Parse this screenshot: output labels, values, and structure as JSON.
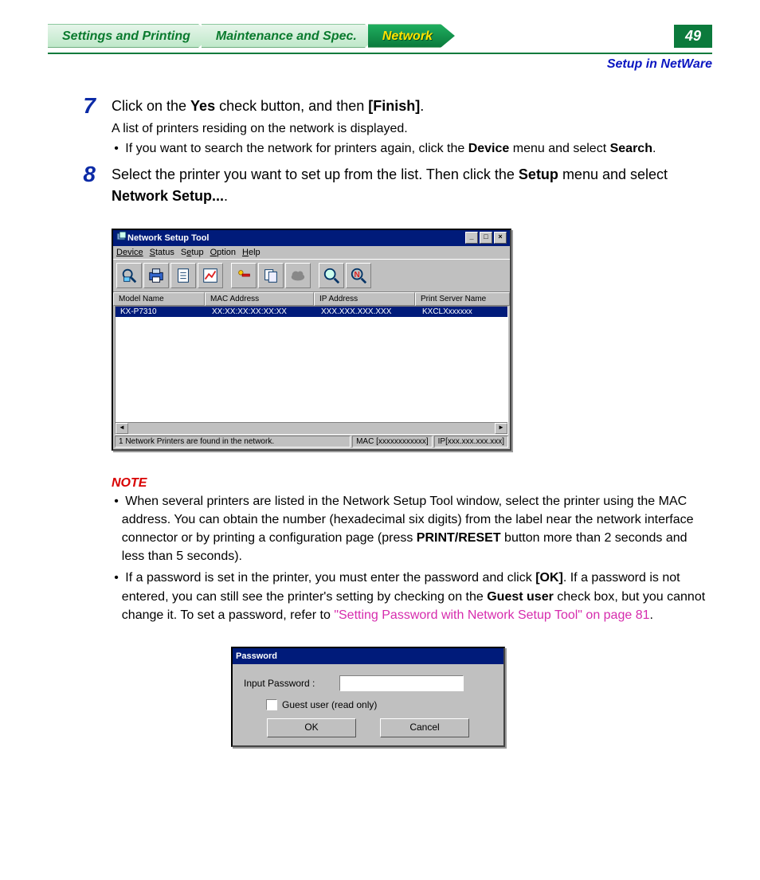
{
  "tabs": {
    "settings": "Settings and Printing",
    "maintenance": "Maintenance and Spec.",
    "network": "Network"
  },
  "page_number": "49",
  "section_path": "Setup in NetWare",
  "step7": {
    "num": "7",
    "line_pre": "Click on the ",
    "yes": "Yes",
    "line_mid": " check button, and then ",
    "finish": "[Finish]",
    "line_post": ".",
    "sub": "A list of printers residing on the network is displayed.",
    "bullet_pre": "If you want to search the network for printers again, click the ",
    "device": "Device",
    "bullet_mid": " menu and select ",
    "search": "Search",
    "bullet_post": "."
  },
  "step8": {
    "num": "8",
    "line_pre": "Select the printer you want to set up from the list. Then click the ",
    "setup": "Setup",
    "line_mid": " menu and select ",
    "ns": "Network Setup...",
    "line_post": "."
  },
  "nst": {
    "title": "Network Setup Tool",
    "menu": {
      "device": "Device",
      "status": "Status",
      "setup": "Setup",
      "option": "Option",
      "help": "Help"
    },
    "cols": {
      "model": "Model Name",
      "mac": "MAC Address",
      "ip": "IP Address",
      "ps": "Print Server Name"
    },
    "row": {
      "model": "KX-P7310",
      "mac": "XX:XX:XX:XX:XX:XX",
      "ip": "XXX.XXX.XXX.XXX",
      "ps": "KXCLXxxxxxx"
    },
    "status_main": "1 Network Printers are found in the network.",
    "status_mac": "MAC [xxxxxxxxxxxx]",
    "status_ip": "IP[xxx.xxx.xxx.xxx]"
  },
  "note": {
    "label": "NOTE",
    "b1_pre": "When several printers are listed in the Network Setup Tool window, select the printer using the MAC address. You can obtain the number (hexadecimal six digits) from the label near the network interface connector or by printing a configuration page (press ",
    "b1_bold": "PRINT/RESET",
    "b1_post": " button more than 2 seconds and less than 5 seconds).",
    "b2_pre": "If a password is set in the printer, you must enter the password and click ",
    "b2_ok": "[OK]",
    "b2_mid": ". If a password is not entered, you can still see the printer's setting by checking on the ",
    "b2_guest": "Guest user",
    "b2_mid2": " check box, but you cannot change it. To set a password, refer to ",
    "b2_link": "\"Setting Password with Network Setup Tool\" on page 81",
    "b2_post": "."
  },
  "pwd": {
    "title": "Password",
    "label": "Input Password :",
    "guest": "Guest user (read only)",
    "ok": "OK",
    "cancel": "Cancel"
  }
}
